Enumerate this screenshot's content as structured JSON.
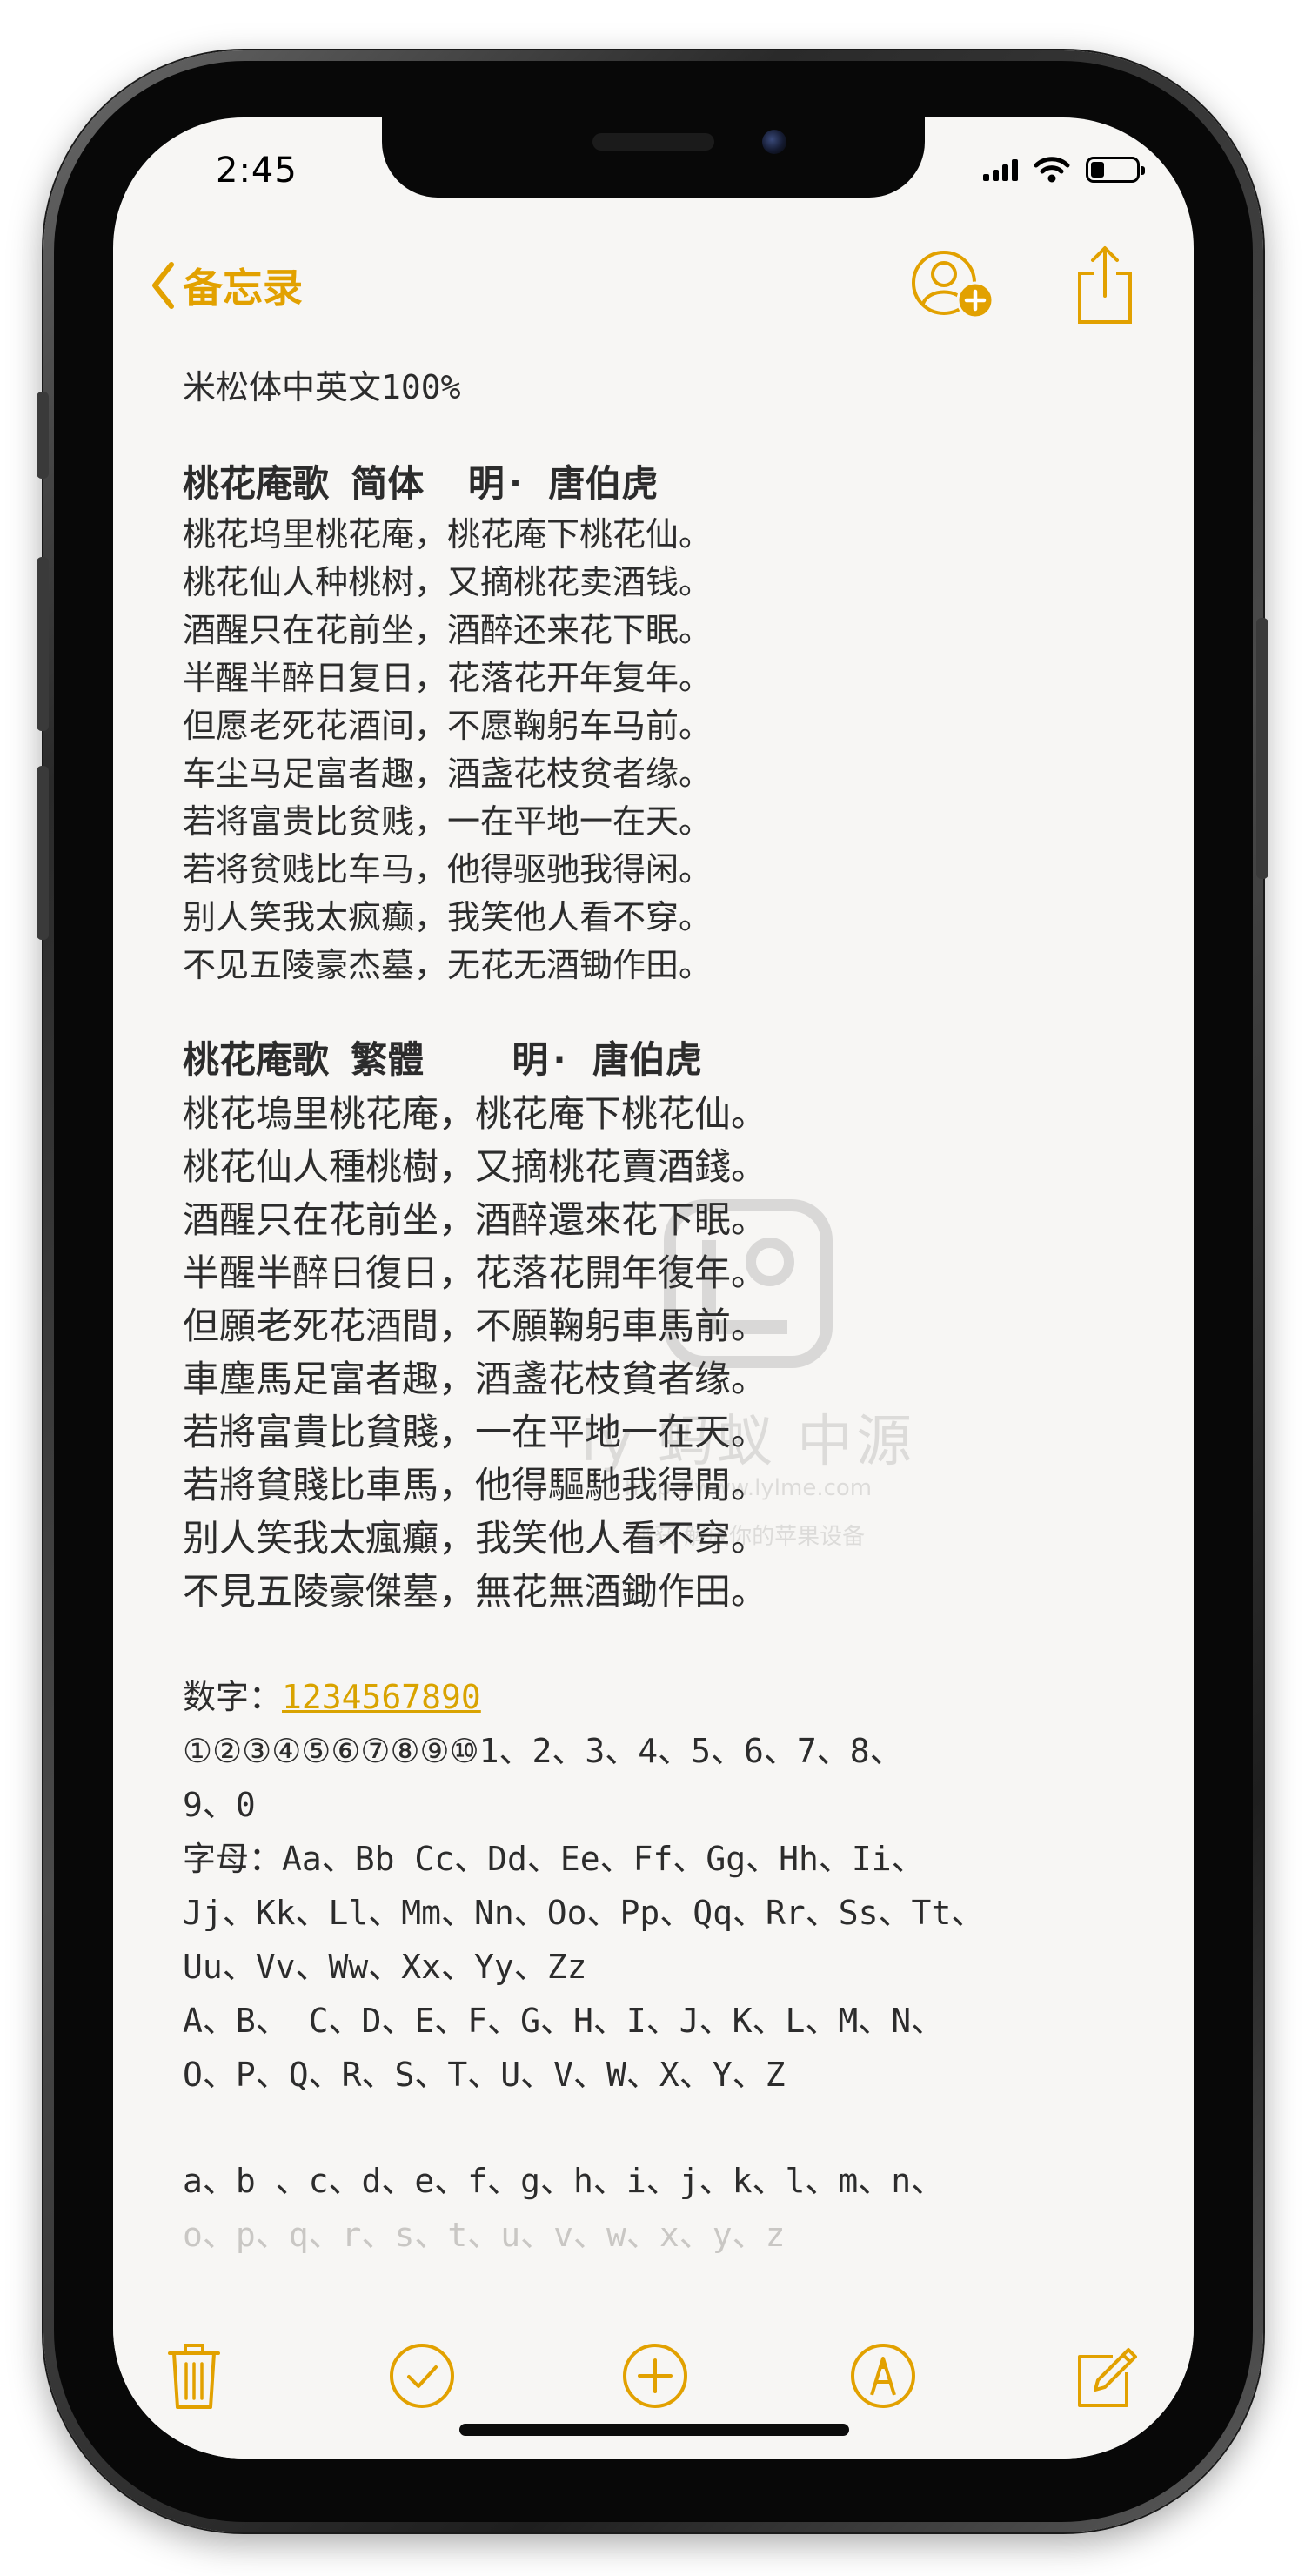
{
  "status_bar": {
    "time": "2:45",
    "icons": [
      "cellular-signal-icon",
      "wifi-icon",
      "battery-icon"
    ]
  },
  "nav": {
    "back_label": "备忘录",
    "back_icon": "chevron-left-icon",
    "add_person_icon": "add-person-icon",
    "share_icon": "share-icon"
  },
  "note": {
    "heading": "米松体中英文100%",
    "simplified": {
      "title": "桃花庵歌 简体  明· 唐伯虎",
      "lines": [
        "桃花坞里桃花庵，桃花庵下桃花仙。",
        "桃花仙人种桃树，又摘桃花卖酒钱。",
        "酒醒只在花前坐，酒醉还来花下眠。",
        "半醒半醉日复日，花落花开年复年。",
        "但愿老死花酒间，不愿鞠躬车马前。",
        "车尘马足富者趣，酒盏花枝贫者缘。",
        "若将富贵比贫贱，一在平地一在天。",
        "若将贫贱比车马，他得驱驰我得闲。",
        "别人笑我太疯癫，我笑他人看不穿。",
        "不见五陵豪杰墓，无花无酒锄作田。"
      ]
    },
    "traditional": {
      "title": "桃花庵歌 繁體    明· 唐伯虎",
      "lines": [
        "桃花塢里桃花庵，桃花庵下桃花仙。",
        "桃花仙人種桃樹，又摘桃花賣酒錢。",
        "酒醒只在花前坐，酒醉還來花下眠。",
        "半醒半醉日復日，花落花開年復年。",
        "但願老死花酒間，不願鞠躬車馬前。",
        "車塵馬足富者趣，酒盞花枝貧者缘。",
        "若將富貴比貧賤，一在平地一在天。",
        "若將貧賤比車馬，他得驅馳我得閒。",
        "别人笑我太瘋癲，我笑他人看不穿。",
        "不見五陵豪傑墓，無花無酒鋤作田。"
      ]
    },
    "digits_label": "数字：",
    "digits_link": "1234567890",
    "digits_lines": [
      "①②③④⑤⑥⑦⑧⑨⑩1、2、3、4、5、6、7、8、",
      "9、0"
    ],
    "letters_lines": [
      "字母：Aa、Bb Cc、Dd、Ee、Ff、Gg、Hh、Ii、",
      "Jj、Kk、Ll、Mm、Nn、Oo、Pp、Qq、Rr、Ss、Tt、",
      "Uu、Vv、Ww、Xx、Yy、Zz",
      "A、B、 C、D、E、F、G、H、I、J、K、L、M、N、",
      "O、P、Q、R、S、T、U、V、W、X、Y、Z"
    ],
    "lower_line": "a、b 、c、d、e、f、g、h、i、j、k、l、m、n、",
    "lower_line_faded": "o、p、q、r、s、t、u、v、w、x、y、z"
  },
  "watermark": {
    "title": "ly  蚂蚁  中源",
    "url": "http://www.lylme.com",
    "subtitle": "越获    解放你的苹果设备"
  },
  "toolbar": {
    "icons": [
      "trash-icon",
      "checklist-icon",
      "add-icon",
      "markup-pen-icon",
      "compose-icon"
    ]
  },
  "colors": {
    "accent": "#e2a100",
    "text": "#2c2c2c",
    "paper": "#f7f6f4"
  }
}
